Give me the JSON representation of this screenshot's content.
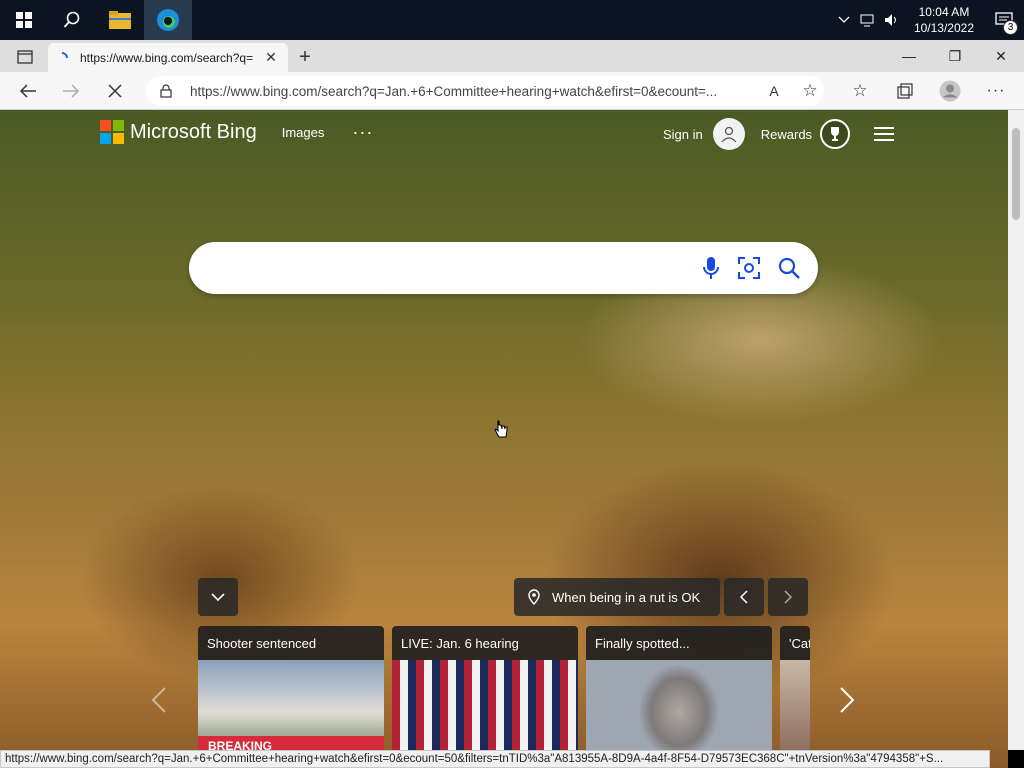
{
  "taskbar": {
    "time": "10:04 AM",
    "date": "10/13/2022",
    "notification_count": "3"
  },
  "browser": {
    "tab_title": "https://www.bing.com/search?q=",
    "url": "https://www.bing.com/search?q=Jan.+6+Committee+hearing+watch&efirst=0&ecount=..."
  },
  "bing": {
    "brand": "Microsoft Bing",
    "nav_images": "Images",
    "nav_more": "···",
    "sign_in": "Sign in",
    "rewards": "Rewards",
    "search_value": "",
    "image_caption": "When being in a rut is OK",
    "cards": [
      {
        "title": "Shooter sentenced",
        "tag": "BREAKING"
      },
      {
        "title": "LIVE: Jan. 6 hearing",
        "tag": ""
      },
      {
        "title": "Finally spotted...",
        "tag": ""
      },
      {
        "title": "'Cat",
        "tag": ""
      }
    ]
  },
  "status_bar": "https://www.bing.com/search?q=Jan.+6+Committee+hearing+watch&efirst=0&ecount=50&filters=tnTID%3a\"A813955A-8D9A-4a4f-8F54-D79573EC368C\"+tnVersion%3a\"4794358\"+S...",
  "colors": {
    "ms_red": "#f25022",
    "ms_green": "#7fba00",
    "ms_blue": "#00a4ef",
    "ms_yellow": "#ffb900",
    "breaking": "#d62b3b"
  }
}
